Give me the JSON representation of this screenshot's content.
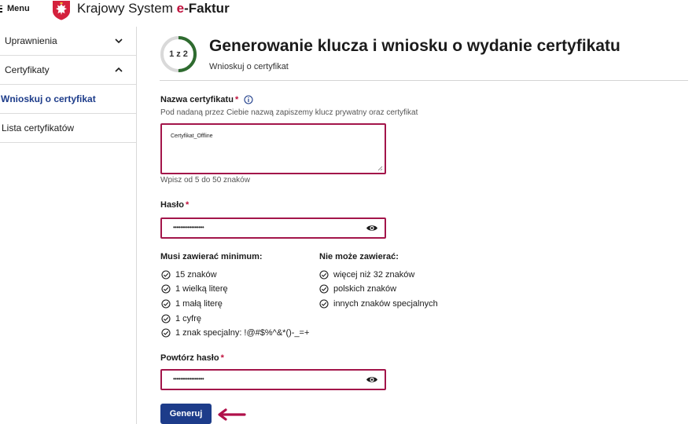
{
  "header": {
    "menu_label": "Menu",
    "brand_prefix": "Krajowy System ",
    "brand_e": "e",
    "brand_suffix": "-Faktur"
  },
  "sidebar": {
    "items": [
      {
        "label": "Uprawnienia",
        "expanded": false
      },
      {
        "label": "Certyfikaty",
        "expanded": true
      },
      {
        "label": "Wnioskuj o certyfikat",
        "active": true
      },
      {
        "label": "Lista certyfikatów"
      }
    ]
  },
  "page": {
    "step": "1 z 2",
    "step_progress": 0.5,
    "title": "Generowanie klucza i wniosku o wydanie certyfikatu",
    "subtitle": "Wnioskuj o certyfikat"
  },
  "form": {
    "name_label": "Nazwa certyfikatu",
    "required_mark": "*",
    "name_hint": "Pod nadaną przez Ciebie nazwą zapiszemy klucz prywatny oraz certyfikat",
    "name_value": "Certyfikat_Offline",
    "name_length_hint": "Wpisz od 5 do 50 znaków",
    "password_label": "Hasło",
    "password_value": "•••••••••••••••••",
    "repeat_label": "Powtórz hasło",
    "repeat_value": "•••••••••••••••••",
    "must_contain_title": "Musi zawierać minimum:",
    "must_contain": [
      "15 znaków",
      "1 wielką literę",
      "1 małą literę",
      "1 cyfrę",
      "1 znak specjalny: !@#$%^&*()-_=+"
    ],
    "must_not_title": "Nie może zawierać:",
    "must_not": [
      "więcej niż 32 znaków",
      "polskich znaków",
      "innych znaków specjalnych"
    ],
    "submit_label": "Generuj"
  },
  "colors": {
    "accent": "#1d3c8a",
    "error_border": "#a3154a",
    "required": "#c0103c",
    "progress": "#2e6b2f",
    "arrow": "#b0104a"
  }
}
